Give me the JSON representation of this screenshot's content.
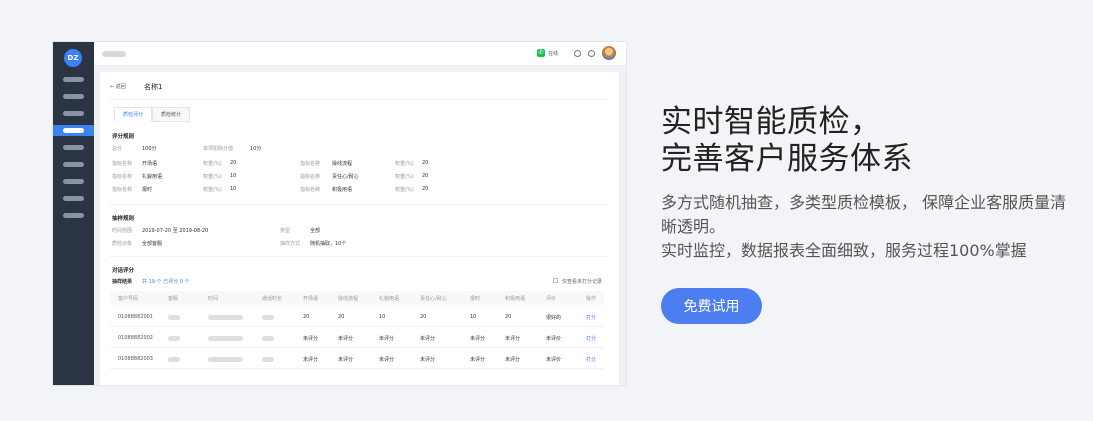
{
  "hero": {
    "title_line1": "实时智能质检，",
    "title_line2": "完善客户服务体系",
    "desc_line1": "多方式随机抽查，多类型质检模板， 保障企业客服质量清",
    "desc_line2": "晰透明。",
    "desc_line3": "实时监控，数据报表全面细致，服务过程100%掌握",
    "cta_label": "免费试用"
  },
  "app": {
    "logo_text": "DZ",
    "online_label": "在线",
    "back_label": "← 返回",
    "page_title": "名称1",
    "tabs": [
      "质检评分",
      "质检统计"
    ],
    "scoring": {
      "section_title": "评分规则",
      "total_label": "总分",
      "total_value": "100分",
      "deduct_label": "单项扣除分值",
      "deduct_value": "10分",
      "metric_label": "指标名称",
      "weight_label": "权重(%)",
      "metrics": [
        {
          "name": "开场语",
          "weight": "20"
        },
        {
          "name": "礼貌用语",
          "weight": "10"
        },
        {
          "name": "报时",
          "weight": "10"
        },
        {
          "name": "操线流程",
          "weight": "20"
        },
        {
          "name": "责任心/耐心",
          "weight": "20"
        },
        {
          "name": "积极用语",
          "weight": "20"
        }
      ]
    },
    "sampling": {
      "section_title": "抽样规则",
      "time_label": "时间范围",
      "time_value": "2019-07-20 至 2019-08-20",
      "type_label": "类型",
      "type_value": "全部",
      "target_label": "质检对象",
      "target_value": "全部客服",
      "method_label": "抽样方式",
      "method_value": "随机抽取，10个"
    },
    "review": {
      "section_title": "对话评分",
      "result_label": "抽样结果",
      "result_value": "共 19 个  已评分 0 个",
      "filter_label": "仅查看未打分记录"
    },
    "table": {
      "headers": [
        "客户号码",
        "客服",
        "时间",
        "通话时长",
        "开场语",
        "操线流程",
        "礼貌用语",
        "责任心/耐心",
        "报时",
        "积极用语",
        "评价",
        "操作"
      ],
      "rows": [
        {
          "phone": "01088882001",
          "scores": [
            "20",
            "20",
            "10",
            "20",
            "10",
            "20"
          ],
          "rating": "很好的",
          "action": "打分"
        },
        {
          "phone": "01088882002",
          "scores": [
            "未评分",
            "未评分",
            "未评分",
            "未评分",
            "未评分",
            "未评分"
          ],
          "rating": "未评价",
          "action": "打分"
        },
        {
          "phone": "01088882003",
          "scores": [
            "未评分",
            "未评分",
            "未评分",
            "未评分",
            "未评分",
            "未评分"
          ],
          "rating": "未评价",
          "action": "打分"
        }
      ]
    }
  }
}
